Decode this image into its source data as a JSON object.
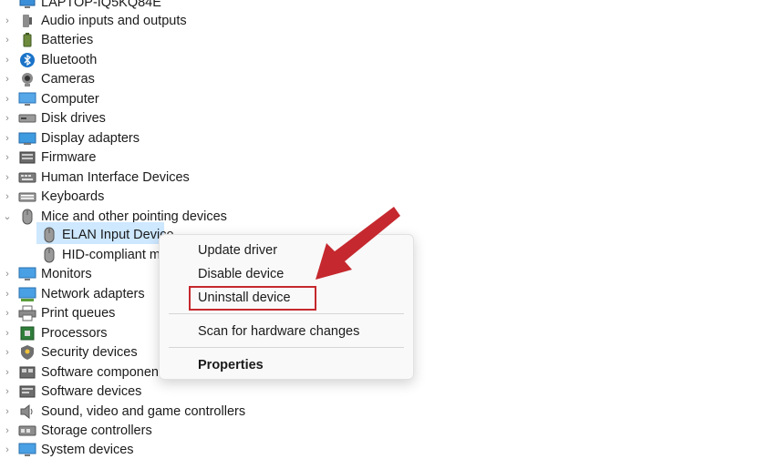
{
  "window": {
    "computer_name": "LAPTOP-IQ5KQ84E"
  },
  "tree": {
    "categories": [
      {
        "label": "Audio inputs and outputs",
        "icon": "speaker-icon"
      },
      {
        "label": "Batteries",
        "icon": "battery-icon"
      },
      {
        "label": "Bluetooth",
        "icon": "bluetooth-icon"
      },
      {
        "label": "Cameras",
        "icon": "camera-icon"
      },
      {
        "label": "Computer",
        "icon": "computer-icon"
      },
      {
        "label": "Disk drives",
        "icon": "disk-drive-icon"
      },
      {
        "label": "Display adapters",
        "icon": "display-adapter-icon"
      },
      {
        "label": "Firmware",
        "icon": "firmware-icon"
      },
      {
        "label": "Human Interface Devices",
        "icon": "hid-icon"
      },
      {
        "label": "Keyboards",
        "icon": "keyboard-icon"
      },
      {
        "label": "Mice and other pointing devices",
        "icon": "mouse-icon",
        "expanded": true
      },
      {
        "label": "Monitors",
        "icon": "monitor-icon"
      },
      {
        "label": "Network adapters",
        "icon": "network-adapter-icon"
      },
      {
        "label": "Print queues",
        "icon": "printer-icon"
      },
      {
        "label": "Processors",
        "icon": "processor-icon"
      },
      {
        "label": "Security devices",
        "icon": "security-icon"
      },
      {
        "label": "Software components",
        "icon": "software-component-icon"
      },
      {
        "label": "Software devices",
        "icon": "software-device-icon"
      },
      {
        "label": "Sound, video and game controllers",
        "icon": "sound-icon"
      },
      {
        "label": "Storage controllers",
        "icon": "storage-controller-icon"
      },
      {
        "label": "System devices",
        "icon": "system-device-icon"
      }
    ],
    "mice_children": [
      {
        "label": "ELAN Input Device",
        "selected": true
      },
      {
        "label": "HID-compliant mouse"
      }
    ]
  },
  "context_menu": {
    "items": [
      "Update driver",
      "Disable device",
      "Uninstall device",
      "Scan for hardware changes",
      "Properties"
    ],
    "highlighted": "Uninstall device"
  },
  "colors": {
    "selection": "#cde8ff",
    "annotation_red": "#c5282e",
    "menu_bg": "#f9f9f9"
  }
}
